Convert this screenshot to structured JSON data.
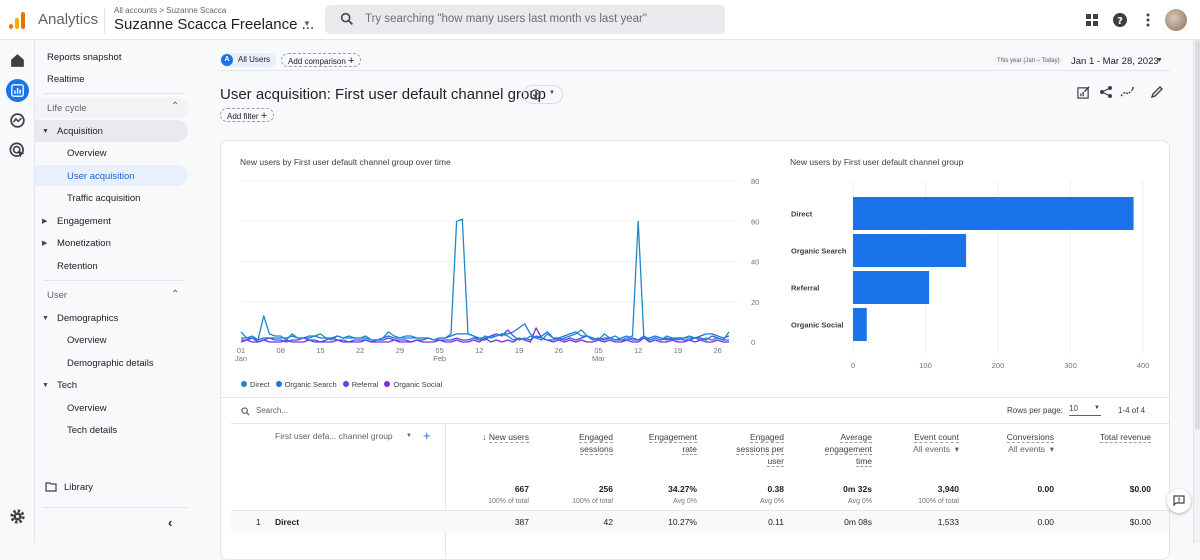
{
  "topbar": {
    "app_name": "Analytics",
    "breadcrumb": "All accounts > Suzanne Scacca",
    "account_name": "Suzanne Scacca Freelance ...",
    "search_placeholder": "Try searching \"how many users last month vs last year\""
  },
  "colors": {
    "accent": "#1a73e8",
    "direct": "#1e88c9",
    "organic_search": "#1a73e8",
    "referral": "#4b4cf0",
    "organic_social": "#7b2fe0",
    "bar": "#1a73e8"
  },
  "rail": {
    "icons": [
      "home-icon",
      "reports-icon",
      "explore-icon",
      "advertising-icon",
      "settings-icon"
    ]
  },
  "nav": {
    "reports_snapshot": "Reports snapshot",
    "realtime": "Realtime",
    "lifecycle": "Life cycle",
    "acquisition": "Acquisition",
    "acq_overview": "Overview",
    "user_acquisition": "User acquisition",
    "traffic_acquisition": "Traffic acquisition",
    "engagement": "Engagement",
    "monetization": "Monetization",
    "retention": "Retention",
    "user": "User",
    "demographics": "Demographics",
    "demo_overview": "Overview",
    "demographic_details": "Demographic details",
    "tech": "Tech",
    "tech_overview": "Overview",
    "tech_details": "Tech details",
    "library": "Library"
  },
  "header": {
    "segment_badge": "A",
    "segment": "All Users",
    "add_comparison": "Add comparison",
    "date_preset": "This year (Jan – Today)",
    "date_range": "Jan 1 - Mar 28, 2023",
    "title": "User acquisition: First user default channel group",
    "add_filter": "Add filter"
  },
  "chart_data": [
    {
      "type": "line",
      "title": "New users by First user default channel group over time",
      "xlabel": "",
      "ylabel": "",
      "ylim": [
        0,
        80
      ],
      "yticks": [
        "80",
        "60",
        "40",
        "20",
        "0"
      ],
      "xticks": [
        {
          "l1": "01",
          "l2": "Jan"
        },
        {
          "l1": "08",
          "l2": ""
        },
        {
          "l1": "15",
          "l2": ""
        },
        {
          "l1": "22",
          "l2": ""
        },
        {
          "l1": "29",
          "l2": ""
        },
        {
          "l1": "05",
          "l2": "Feb"
        },
        {
          "l1": "12",
          "l2": ""
        },
        {
          "l1": "19",
          "l2": ""
        },
        {
          "l1": "26",
          "l2": ""
        },
        {
          "l1": "05",
          "l2": "Mar"
        },
        {
          "l1": "12",
          "l2": ""
        },
        {
          "l1": "19",
          "l2": ""
        },
        {
          "l1": "26",
          "l2": ""
        }
      ],
      "days": 87,
      "legend_position": "bottom-left",
      "series": [
        {
          "name": "Direct",
          "values": [
            5,
            2,
            3,
            1,
            13,
            4,
            3,
            3,
            1,
            4,
            2,
            2,
            3,
            3,
            4,
            2,
            1,
            3,
            2,
            3,
            2,
            2,
            3,
            1,
            1,
            2,
            5,
            3,
            2,
            3,
            3,
            2,
            2,
            2,
            1,
            2,
            2,
            4,
            60,
            61,
            4,
            3,
            1,
            3,
            2,
            3,
            4,
            3,
            1,
            2,
            1,
            3,
            2,
            1,
            4,
            2,
            1,
            2,
            3,
            4,
            6,
            3,
            2,
            1,
            4,
            2,
            3,
            1,
            2,
            3,
            60,
            2,
            1,
            2,
            1,
            3,
            2,
            1,
            2,
            3,
            2,
            1,
            2,
            1,
            2,
            1,
            5
          ]
        },
        {
          "name": "Organic Search",
          "values": [
            2,
            2,
            2,
            1,
            2,
            2,
            2,
            2,
            2,
            3,
            2,
            2,
            2,
            3,
            2,
            2,
            2,
            3,
            2,
            2,
            2,
            2,
            2,
            1,
            1,
            2,
            3,
            2,
            2,
            2,
            2,
            2,
            2,
            2,
            1,
            2,
            2,
            3,
            4,
            4,
            4,
            3,
            2,
            2,
            3,
            3,
            4,
            4,
            5,
            7,
            9,
            4,
            2,
            3,
            5,
            2,
            2,
            3,
            4,
            5,
            3,
            3,
            2,
            1,
            2,
            2,
            1,
            2,
            3,
            1,
            1,
            2,
            2,
            3,
            2,
            1,
            2,
            2,
            2,
            2,
            2,
            3,
            4,
            4,
            3,
            2,
            3
          ]
        },
        {
          "name": "Referral",
          "values": [
            1,
            1,
            2,
            0,
            1,
            2,
            1,
            1,
            0,
            1,
            1,
            2,
            1,
            1,
            0,
            1,
            2,
            1,
            1,
            0,
            1,
            1,
            1,
            0,
            1,
            1,
            2,
            1,
            1,
            1,
            0,
            1,
            1,
            2,
            1,
            1,
            1,
            1,
            2,
            1,
            1,
            2,
            1,
            1,
            3,
            4,
            3,
            6,
            3,
            1,
            2,
            1,
            3,
            2,
            1,
            1,
            2,
            1,
            2,
            1,
            2,
            3,
            1,
            2,
            1,
            2,
            1,
            1,
            1,
            2,
            1,
            3,
            1,
            2,
            1,
            2,
            1,
            2,
            1,
            1,
            2,
            2,
            1,
            3,
            2,
            1,
            1
          ]
        },
        {
          "name": "Organic Social",
          "values": [
            0,
            1,
            0,
            0,
            1,
            0,
            0,
            0,
            1,
            0,
            0,
            0,
            1,
            0,
            0,
            0,
            0,
            1,
            0,
            0,
            0,
            0,
            1,
            0,
            0,
            0,
            0,
            1,
            0,
            0,
            0,
            1,
            0,
            0,
            0,
            1,
            0,
            0,
            1,
            0,
            0,
            1,
            0,
            2,
            0,
            1,
            0,
            1,
            0,
            2,
            1,
            0,
            7,
            2,
            1,
            0,
            1,
            0,
            1,
            0,
            1,
            0,
            0,
            1,
            0,
            1,
            0,
            0,
            1,
            0,
            0,
            2,
            0,
            1,
            0,
            0,
            1,
            0,
            0,
            1,
            0,
            1,
            0,
            0,
            1,
            0,
            0
          ]
        }
      ]
    },
    {
      "type": "bar",
      "orientation": "horizontal",
      "title": "New users by First user default channel group",
      "categories": [
        "Direct",
        "Organic Search",
        "Referral",
        "Organic Social"
      ],
      "values": [
        387,
        156,
        105,
        19
      ],
      "xlim": [
        0,
        400
      ],
      "xticks": [
        "0",
        "100",
        "200",
        "300",
        "400"
      ],
      "grid": true
    }
  ],
  "table": {
    "search_placeholder": "Search...",
    "rows_per_page_label": "Rows per page:",
    "rows_per_page": "10",
    "pagination": "1-4 of 4",
    "dimension_header": "First user defa... channel group",
    "columns": [
      {
        "h1": "New users",
        "h2": "",
        "h3": "",
        "total": "667",
        "sub": "100% of total",
        "sorted": true
      },
      {
        "h1": "Engaged",
        "h2": "sessions",
        "h3": "",
        "total": "256",
        "sub": "100% of total"
      },
      {
        "h1": "Engagement",
        "h2": "rate",
        "h3": "",
        "total": "34.27%",
        "sub": "Avg 0%"
      },
      {
        "h1": "Engaged",
        "h2": "sessions per",
        "h3": "user",
        "total": "0.38",
        "sub": "Avg 0%"
      },
      {
        "h1": "Average",
        "h2": "engagement",
        "h3": "time",
        "total": "0m 32s",
        "sub": "Avg 0%"
      },
      {
        "h1": "Event count",
        "h2": "All events",
        "h3": "",
        "total": "3,940",
        "sub": "100% of total",
        "dropdown": true
      },
      {
        "h1": "Conversions",
        "h2": "All events",
        "h3": "",
        "total": "0.00",
        "sub": "",
        "dropdown": true
      },
      {
        "h1": "Total revenue",
        "h2": "",
        "h3": "",
        "total": "$0.00",
        "sub": ""
      }
    ],
    "rows": [
      {
        "index": "1",
        "name": "Direct",
        "values": [
          "387",
          "42",
          "10.27%",
          "0.11",
          "0m 08s",
          "1,533",
          "0.00",
          "$0.00"
        ]
      }
    ]
  }
}
